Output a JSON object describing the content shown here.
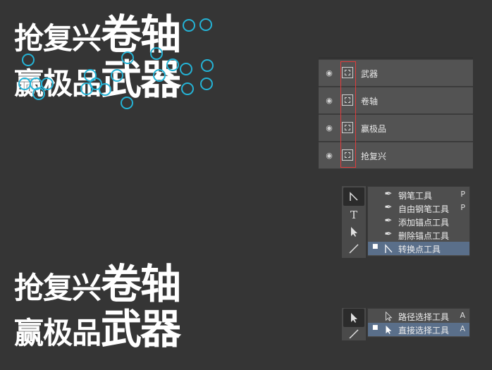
{
  "artwork": {
    "line1_small": "抢复兴",
    "line1_big": "卷轴",
    "line2_small": "赢极品",
    "line2_big": "武器"
  },
  "layers": [
    {
      "name": "武器",
      "icon": "eye-icon"
    },
    {
      "name": "卷轴",
      "icon": "eye-icon"
    },
    {
      "name": "赢极品",
      "icon": "eye-icon"
    },
    {
      "name": "抢复兴",
      "icon": "eye-icon"
    }
  ],
  "pen_menu": {
    "items": [
      {
        "label": "钢笔工具",
        "key": "P",
        "icon": "pen-icon",
        "selected": false
      },
      {
        "label": "自由钢笔工具",
        "key": "P",
        "icon": "freeform-pen-icon",
        "selected": false
      },
      {
        "label": "添加锚点工具",
        "key": "",
        "icon": "add-anchor-icon",
        "selected": false
      },
      {
        "label": "删除锚点工具",
        "key": "",
        "icon": "delete-anchor-icon",
        "selected": false
      },
      {
        "label": "转换点工具",
        "key": "",
        "icon": "convert-point-icon",
        "selected": true
      }
    ]
  },
  "select_menu": {
    "items": [
      {
        "label": "路径选择工具",
        "key": "A",
        "icon": "path-select-icon",
        "selected": false
      },
      {
        "label": "直接选择工具",
        "key": "A",
        "icon": "direct-select-icon",
        "selected": true
      }
    ]
  },
  "colors": {
    "background": "#353535",
    "anchor": "#24b3d6",
    "highlight_box": "#e23b3b",
    "selected_item": "#5a6f8a"
  }
}
